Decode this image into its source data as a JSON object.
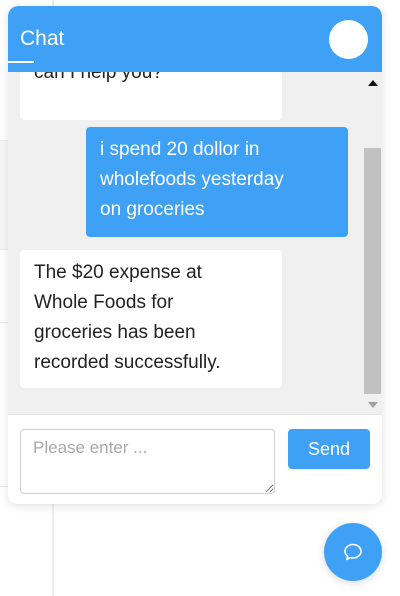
{
  "header": {
    "title": "Chat"
  },
  "messages": [
    {
      "sender": "bot",
      "lines": [
        "can I help you?"
      ]
    },
    {
      "sender": "user",
      "lines": [
        "i spend 20 dollor in",
        "wholefoods yesterday",
        "on groceries"
      ]
    },
    {
      "sender": "bot",
      "lines": [
        "The $20 expense at",
        "Whole Foods for",
        "groceries has been",
        "recorded successfully."
      ]
    }
  ],
  "composer": {
    "placeholder": "Please enter ...",
    "value": "",
    "send_label": "Send"
  },
  "icons": {
    "launcher": "chat-bubble-icon"
  },
  "colors": {
    "accent": "#3fa1f5",
    "message_area": "#f0f0f0"
  }
}
